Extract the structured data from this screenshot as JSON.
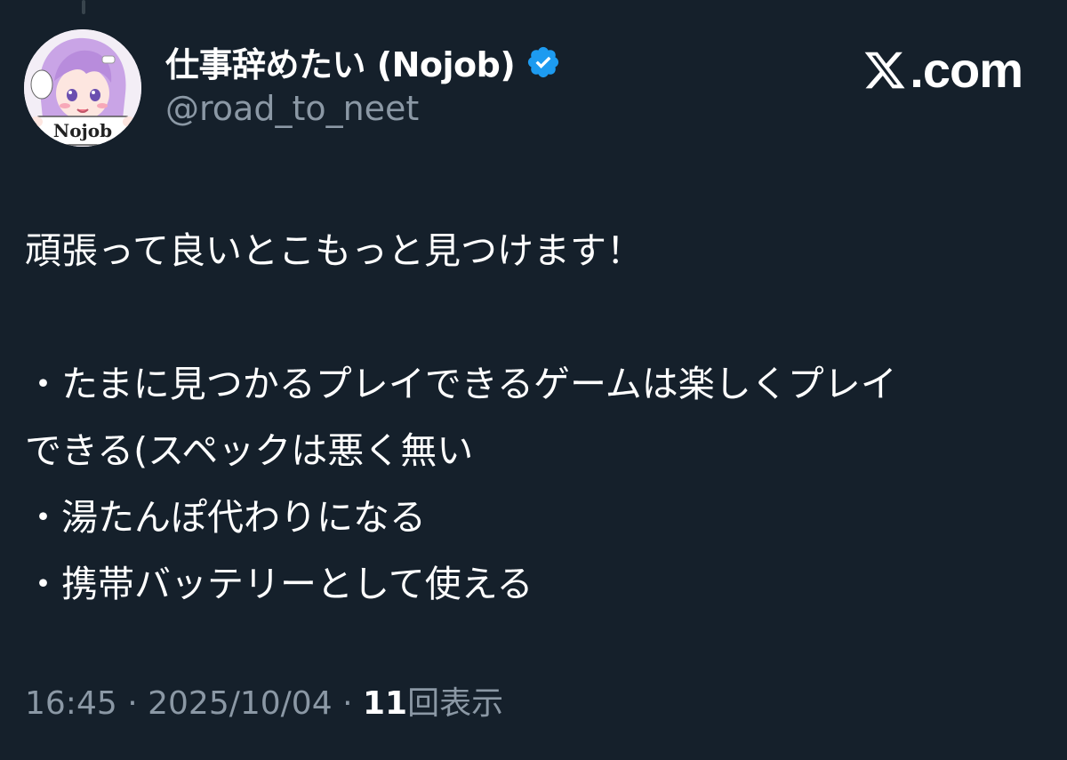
{
  "author": {
    "display_name": "仕事辞めたい (Nojob)",
    "handle": "@road_to_neet",
    "verified": true,
    "avatar_sign_text": "Nojob"
  },
  "site": {
    "logo_text": ".com"
  },
  "tweet": {
    "lines": [
      "頑張って良いとこもっと見つけます！",
      "",
      "・たまに見つかるプレイできるゲームは楽しくプレイ",
      "できる(スペックは悪く無い",
      "・湯たんぽ代わりになる",
      "・携帯バッテリーとして使える"
    ]
  },
  "meta": {
    "time": "16:45",
    "separator": "·",
    "date": "2025/10/04",
    "views_count": "11",
    "views_label": "回表示"
  },
  "colors": {
    "background": "#15202b",
    "text": "#ffffff",
    "secondary_text": "#8b98a5",
    "verified_badge": "#1d9bf0"
  }
}
